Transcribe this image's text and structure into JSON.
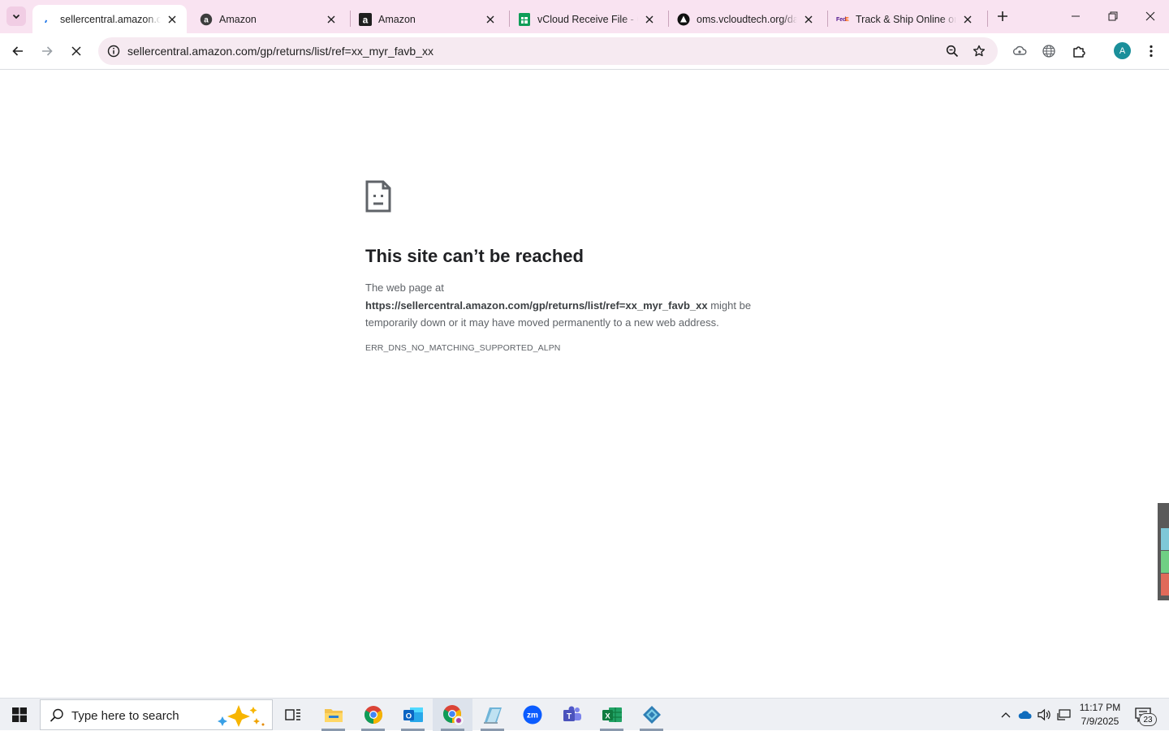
{
  "browser": {
    "tabs": [
      {
        "title": "sellercentral.amazon.com/gp/returns/list/ref=xx_myr_favb_xx",
        "active": true,
        "favicon": "loading-spinner-icon"
      },
      {
        "title": "Amazon",
        "active": false,
        "favicon": "amazon-a-icon"
      },
      {
        "title": "Amazon",
        "active": false,
        "favicon": "amazon-a-icon"
      },
      {
        "title": "vCloud Receive File - Google Sheets",
        "active": false,
        "favicon": "sheets-icon"
      },
      {
        "title": "oms.vcloudtech.org/dashboard",
        "active": false,
        "favicon": "vcloud-icon"
      },
      {
        "title": "Track & Ship Online or Find Locations",
        "active": false,
        "favicon": "fedex-icon"
      }
    ],
    "address_bar": {
      "url": "sellercentral.amazon.com/gp/returns/list/ref=xx_myr_favb_xx"
    },
    "profile_initial": "A",
    "accent_color": "#f9e3f1"
  },
  "error_page": {
    "title": "This site can’t be reached",
    "body_prefix": "The web page at",
    "url": "https://sellercentral.amazon.com/gp/returns/list/ref=xx_myr_favb_xx",
    "body_suffix": " might be temporarily down or it may have moved permanently to a new web address.",
    "error_code": "ERR_DNS_NO_MATCHING_SUPPORTED_ALPN"
  },
  "taskbar": {
    "search_placeholder": "Type here to search",
    "apps": [
      "task-view-icon",
      "file-explorer-icon",
      "chrome-icon",
      "outlook-icon",
      "chrome-profile-icon",
      "paper-app-icon",
      "zoom-icon",
      "teams-icon",
      "excel-icon",
      "app-diamond-icon"
    ],
    "clock": {
      "time": "11:17 PM",
      "date": "7/9/2025"
    },
    "notification_count": "23"
  }
}
